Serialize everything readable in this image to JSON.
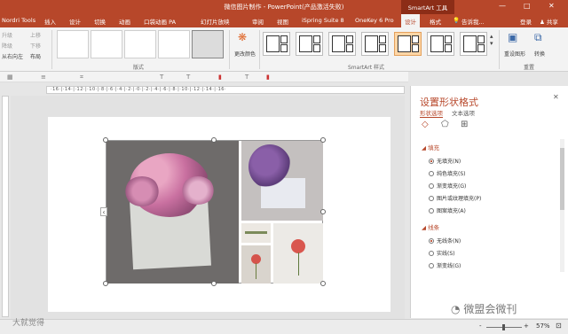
{
  "window": {
    "title": "微信图片制作 - PowerPoint(产品激活失败)",
    "context_tab": "SmartArt 工具",
    "controls": [
      "—",
      "□",
      "✕"
    ]
  },
  "left_tab": "Nordri Tools",
  "tabs": [
    "插入",
    "设计",
    "切换",
    "动画",
    "口袋动画 PA",
    "幻灯片放映",
    "审阅",
    "视图",
    "iSpring Suite 8",
    "OneKey 6 Pro",
    "设计",
    "格式"
  ],
  "active_tab": "设计",
  "search": "告诉我...",
  "user": "登录",
  "share": "共享",
  "ribbon": {
    "left_items": [
      "升级",
      "降级",
      "从右向左",
      "上移",
      "下移",
      "布局"
    ],
    "group_layouts": "版式",
    "color_button": "更改颜色",
    "group_styles": "SmartArt 样式",
    "reset_button": "重设图形",
    "convert_button": "转换",
    "group_reset": "重置"
  },
  "ruler_text": "·16·|·14·|·12·|·10·|·8·|·6·|·4·|·2·|·0·|·2·|·4·|·6·|·8·|·10·|·12·|·14·|·16·",
  "pane": {
    "title": "设置形状格式",
    "tabs": [
      "形状选项",
      "文本选项"
    ],
    "fill_section": "填充",
    "fill_options": [
      {
        "label": "无填充(N)",
        "selected": true
      },
      {
        "label": "纯色填充(S)",
        "selected": false
      },
      {
        "label": "渐变填充(G)",
        "selected": false
      },
      {
        "label": "图片或纹理填充(P)",
        "selected": false
      },
      {
        "label": "图案填充(A)",
        "selected": false
      }
    ],
    "line_section": "线条",
    "line_options": [
      {
        "label": "无线条(N)",
        "selected": true
      },
      {
        "label": "实线(S)",
        "selected": false
      },
      {
        "label": "渐变线(G)",
        "selected": false
      }
    ]
  },
  "status": {
    "zoom": "57%",
    "minus": "-",
    "plus": "+"
  },
  "watermark_left": "大就觉得",
  "watermark_right": "微盟会微刊",
  "colors": {
    "accent": "#b7472a",
    "accent_dark": "#8c2d17",
    "ribbon_bg": "#f3f3f3"
  }
}
